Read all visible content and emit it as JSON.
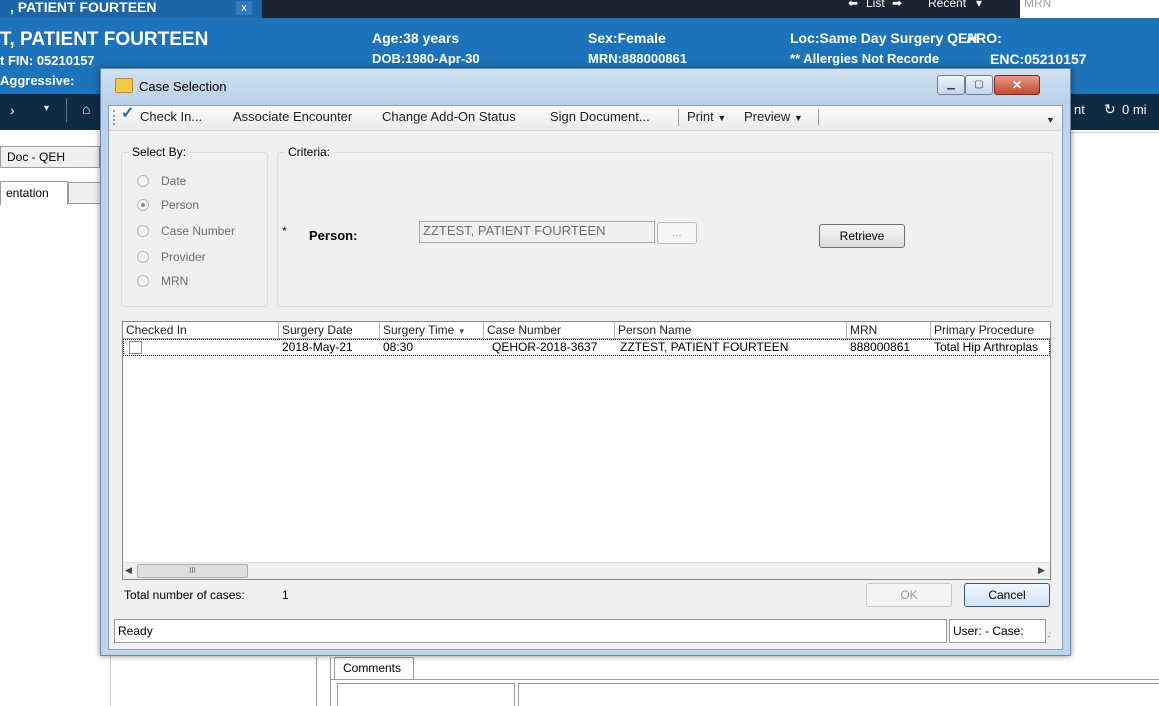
{
  "app": {
    "tab_title": ", PATIENT FOURTEEN",
    "tab_close": "x",
    "nav_list": "List",
    "nav_recent": "Recent",
    "mrn_placeholder": "MRN"
  },
  "banner": {
    "name": "T, PATIENT FOURTEEN",
    "fin": "t FIN: 05210157",
    "aggressive": "Aggressive:",
    "age": "Age:38 years",
    "dob": "DOB:1980-Apr-30",
    "sex": "Sex:Female",
    "mrn": "MRN:888000861",
    "loc": "Loc:Same Day Surgery QEH",
    "aro": "ARO:",
    "allergies": "** Allergies Not Recorde",
    "enc": "ENC:05210157"
  },
  "app_toolbar": {
    "right_label": "nt",
    "refresh_label": "0 mi"
  },
  "left_panel": {
    "doc_button": "Doc - QEH",
    "tab_label": "entation"
  },
  "comments": {
    "tab": "Comments"
  },
  "dialog": {
    "title": "Case Selection",
    "toolbar": {
      "check_in": "Check In...",
      "associate": "Associate Encounter",
      "add_on": "Change Add-On Status",
      "sign": "Sign Document...",
      "print": "Print",
      "preview": "Preview"
    },
    "select_by": {
      "legend": "Select By:",
      "options": [
        "Date",
        "Person",
        "Case Number",
        "Provider",
        "MRN"
      ],
      "selected": "Person"
    },
    "criteria": {
      "legend": "Criteria:",
      "required_mark": "*",
      "person_label": "Person:",
      "person_value": "ZZTEST, PATIENT FOURTEEN",
      "browse_label": "...",
      "retrieve_label": "Retrieve"
    },
    "grid": {
      "columns": [
        "Checked In",
        "Surgery Date",
        "Surgery Time",
        "Case Number",
        "Person Name",
        "MRN",
        "Primary Procedure"
      ],
      "rows": [
        {
          "checked_in": false,
          "surgery_date": "2018-May-21",
          "surgery_time": "08:30",
          "case_number": "QEHOR-2018-3637",
          "person_name": "ZZTEST, PATIENT FOURTEEN",
          "mrn": "888000861",
          "primary_procedure": "Total Hip Arthroplas"
        }
      ],
      "scroll_thumb": "III"
    },
    "footer": {
      "total_label": "Total number of cases:",
      "total_value": "1",
      "ok_label": "OK",
      "cancel_label": "Cancel"
    },
    "status": {
      "text": "Ready",
      "user_case": "User:  - Case:"
    }
  },
  "colors": {
    "banner": "#1c73b9",
    "toolbar_dark": "#0f2a45",
    "dialog_frame": "#bcd3ea",
    "dialog_body": "#f0f0f0"
  }
}
